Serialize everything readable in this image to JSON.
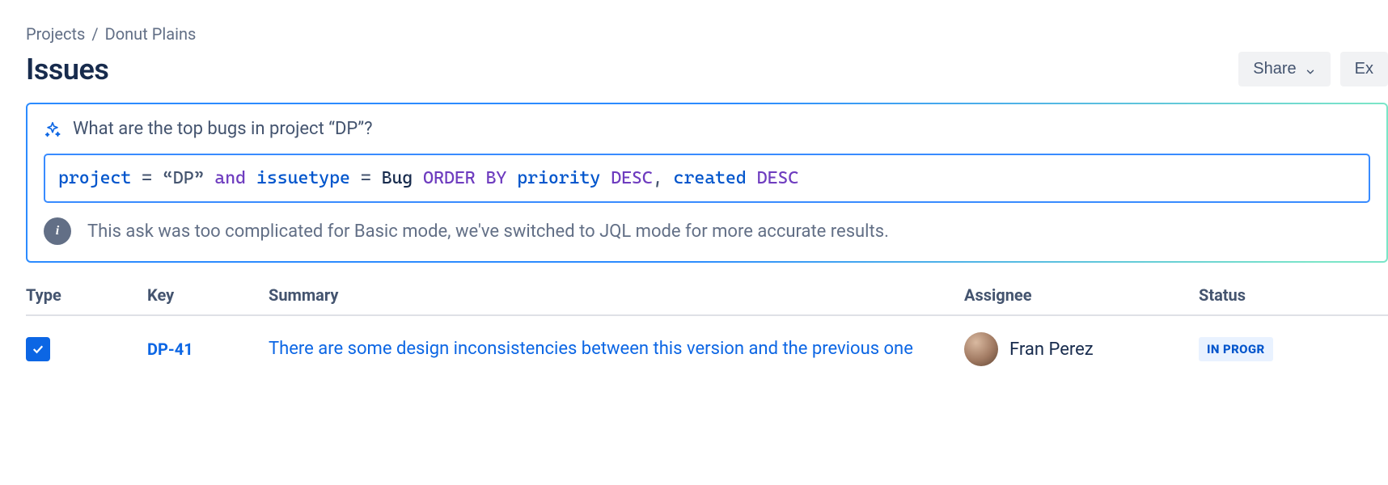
{
  "breadcrumb": {
    "root": "Projects",
    "separator": "/",
    "project": "Donut Plains"
  },
  "page_title": "Issues",
  "actions": {
    "share": "Share",
    "export": "Ex"
  },
  "ai": {
    "prompt": "What are the top bugs in project “DP”?",
    "jql_tokens": [
      {
        "t": "project",
        "c": "field"
      },
      {
        "t": " = ",
        "c": "op"
      },
      {
        "t": "“DP”",
        "c": "str"
      },
      {
        "t": " ",
        "c": "op"
      },
      {
        "t": "and",
        "c": "keyword"
      },
      {
        "t": " ",
        "c": "op"
      },
      {
        "t": "issuetype",
        "c": "field"
      },
      {
        "t": " = ",
        "c": "op"
      },
      {
        "t": "Bug",
        "c": "val"
      },
      {
        "t": " ",
        "c": "op"
      },
      {
        "t": "ORDER BY",
        "c": "keyword"
      },
      {
        "t": " ",
        "c": "op"
      },
      {
        "t": "priority",
        "c": "field"
      },
      {
        "t": " ",
        "c": "op"
      },
      {
        "t": "DESC",
        "c": "keyword"
      },
      {
        "t": ",",
        "c": "op"
      },
      {
        "t": " ",
        "c": "op"
      },
      {
        "t": "created",
        "c": "field"
      },
      {
        "t": " ",
        "c": "op"
      },
      {
        "t": "DESC",
        "c": "keyword"
      }
    ],
    "info": "This ask was too complicated for Basic mode, we've switched to JQL mode for more accurate results."
  },
  "table": {
    "headers": {
      "type": "Type",
      "key": "Key",
      "summary": "Summary",
      "assignee": "Assignee",
      "status": "Status"
    },
    "rows": [
      {
        "key": "DP-41",
        "summary": "There are some design inconsistencies between this version and the previous one",
        "assignee": "Fran Perez",
        "status": "IN PROGR"
      }
    ]
  }
}
